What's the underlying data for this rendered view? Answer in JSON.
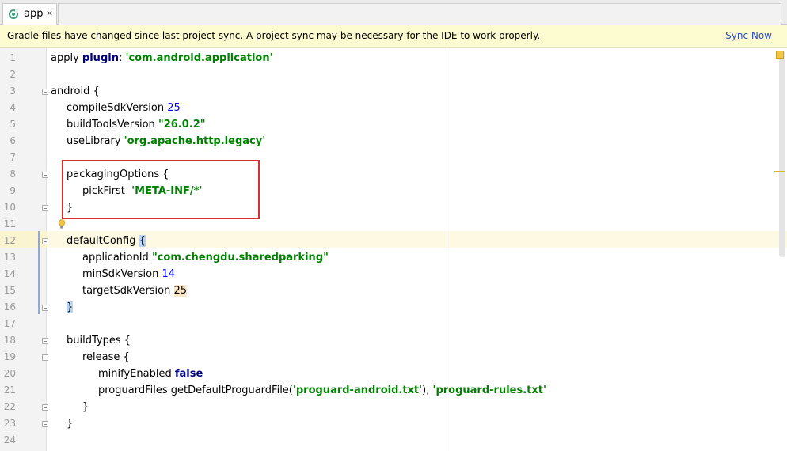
{
  "tab": {
    "label": "app",
    "close": "×"
  },
  "notification": {
    "message": "Gradle files have changed since last project sync. A project sync may be necessary for the IDE to work properly.",
    "action": "Sync Now"
  },
  "editor": {
    "lines": [
      {
        "num": "1",
        "indent": 0,
        "tokens": [
          [
            "t",
            "apply "
          ],
          [
            "kw",
            "plugin"
          ],
          [
            "t",
            ": "
          ],
          [
            "str",
            "'com.android.application'"
          ]
        ]
      },
      {
        "num": "2",
        "indent": 0,
        "tokens": []
      },
      {
        "num": "3",
        "indent": 0,
        "tokens": [
          [
            "t",
            "android {"
          ]
        ]
      },
      {
        "num": "4",
        "indent": 1,
        "tokens": [
          [
            "t",
            "compileSdkVersion "
          ],
          [
            "num",
            "25"
          ]
        ]
      },
      {
        "num": "5",
        "indent": 1,
        "tokens": [
          [
            "t",
            "buildToolsVersion "
          ],
          [
            "str",
            "\"26.0.2\""
          ]
        ]
      },
      {
        "num": "6",
        "indent": 1,
        "tokens": [
          [
            "t",
            "useLibrary "
          ],
          [
            "str",
            "'org.apache.http.legacy'"
          ]
        ]
      },
      {
        "num": "7",
        "indent": 0,
        "tokens": []
      },
      {
        "num": "8",
        "indent": 1,
        "tokens": [
          [
            "t",
            "packagingOptions {"
          ]
        ]
      },
      {
        "num": "9",
        "indent": 2,
        "tokens": [
          [
            "t",
            "pickFirst  "
          ],
          [
            "str",
            "'META-INF/*'"
          ]
        ]
      },
      {
        "num": "10",
        "indent": 1,
        "tokens": [
          [
            "t",
            "}"
          ]
        ]
      },
      {
        "num": "11",
        "indent": 0,
        "tokens": []
      },
      {
        "num": "12",
        "indent": 1,
        "tokens": [
          [
            "t",
            "defaultConfig "
          ],
          [
            "brace",
            "{"
          ]
        ]
      },
      {
        "num": "13",
        "indent": 2,
        "tokens": [
          [
            "t",
            "applicationId "
          ],
          [
            "str",
            "\"com.chengdu.sharedparking\""
          ]
        ]
      },
      {
        "num": "14",
        "indent": 2,
        "tokens": [
          [
            "t",
            "minSdkVersion "
          ],
          [
            "num",
            "14"
          ]
        ]
      },
      {
        "num": "15",
        "indent": 2,
        "tokens": [
          [
            "t",
            "targetSdkVersion "
          ],
          [
            "numhl",
            "25"
          ]
        ]
      },
      {
        "num": "16",
        "indent": 1,
        "tokens": [
          [
            "brace",
            "}"
          ]
        ]
      },
      {
        "num": "17",
        "indent": 0,
        "tokens": []
      },
      {
        "num": "18",
        "indent": 1,
        "tokens": [
          [
            "t",
            "buildTypes {"
          ]
        ]
      },
      {
        "num": "19",
        "indent": 2,
        "tokens": [
          [
            "t",
            "release {"
          ]
        ]
      },
      {
        "num": "20",
        "indent": 3,
        "tokens": [
          [
            "t",
            "minifyEnabled "
          ],
          [
            "bool",
            "false"
          ]
        ]
      },
      {
        "num": "21",
        "indent": 3,
        "tokens": [
          [
            "t",
            "proguardFiles getDefaultProguardFile("
          ],
          [
            "str",
            "'proguard-android.txt'"
          ],
          [
            "t",
            "), "
          ],
          [
            "str",
            "'proguard-rules.txt'"
          ]
        ]
      },
      {
        "num": "22",
        "indent": 2,
        "tokens": [
          [
            "t",
            "}"
          ]
        ]
      },
      {
        "num": "23",
        "indent": 1,
        "tokens": [
          [
            "t",
            "}"
          ]
        ]
      },
      {
        "num": "24",
        "indent": 0,
        "tokens": []
      }
    ],
    "fold_lines": [
      "3",
      "8",
      "10",
      "12",
      "16",
      "18",
      "19",
      "22",
      "23"
    ]
  },
  "colors": {
    "keyword": "#000080",
    "string": "#008000",
    "number": "#0000ff",
    "notification_bg": "#fdfbd0",
    "highlight_box": "#d9302c"
  },
  "icons": {
    "tab": "gradle-app-icon",
    "intention": "lightbulb-icon"
  }
}
